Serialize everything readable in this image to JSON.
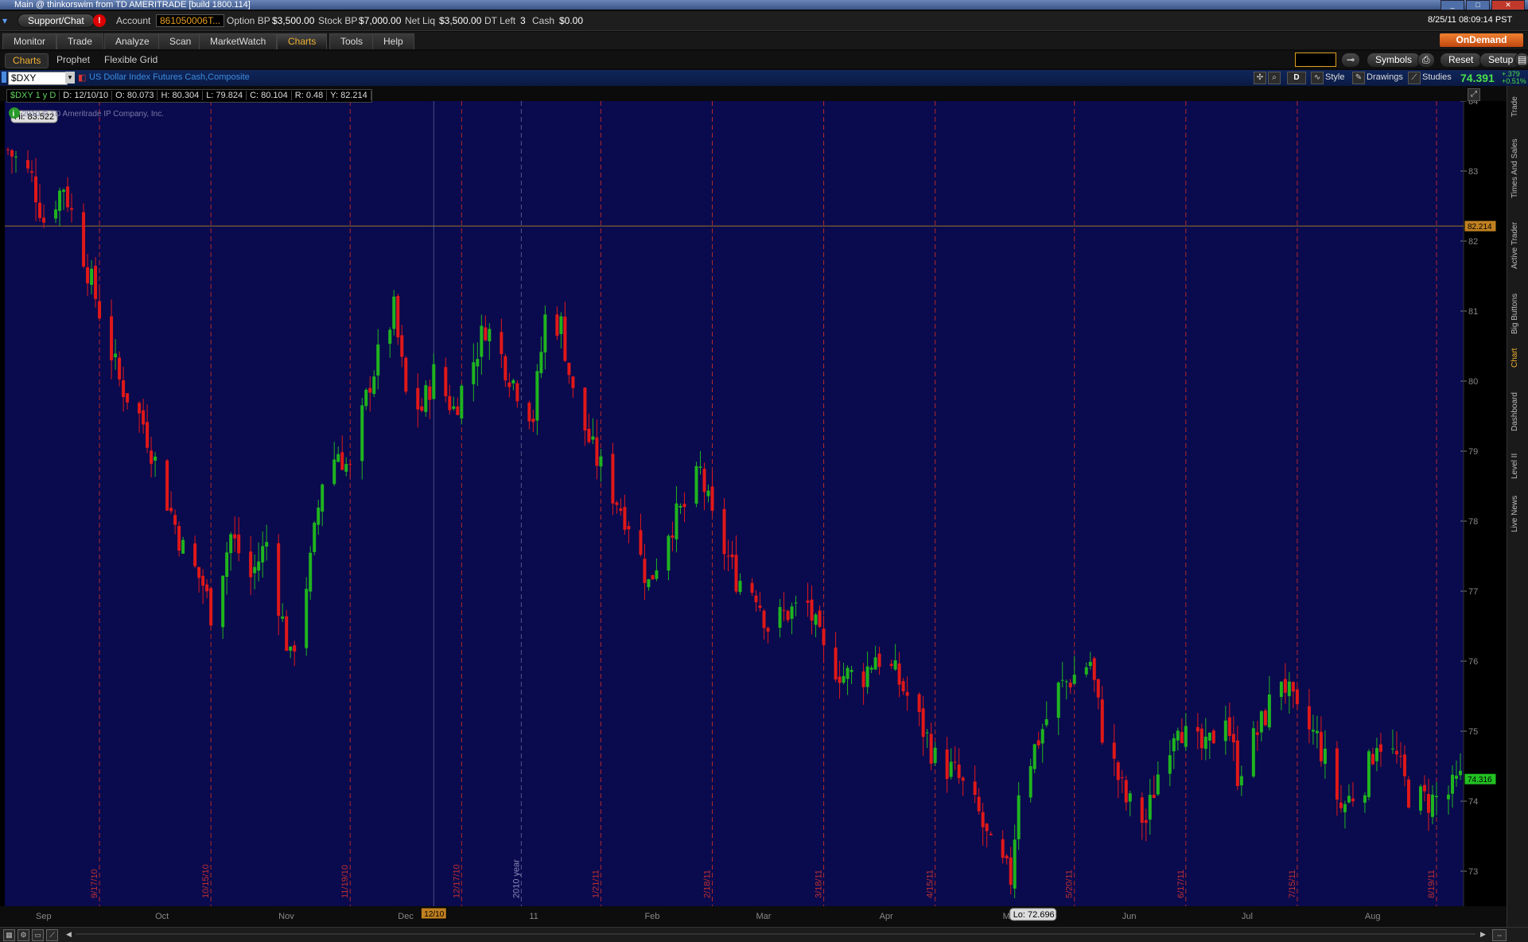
{
  "window": {
    "title": "Main @ thinkorswim from TD AMERITRADE [build 1800.114]"
  },
  "account_bar": {
    "support_label": "Support/Chat",
    "alert_symbol": "!",
    "account_label": "Account",
    "account_value": "861050006T...",
    "option_bp_label": "Option BP",
    "option_bp_value": "$3,500.00",
    "stock_bp_label": "Stock BP",
    "stock_bp_value": "$7,000.00",
    "net_liq_label": "Net Liq",
    "net_liq_value": "$3,500.00",
    "dt_left_label": "DT Left",
    "dt_left_value": "3",
    "cash_label": "Cash",
    "cash_value": "$0.00",
    "datetime": "8/25/11 08:09:14 PST"
  },
  "main_tabs": [
    {
      "label": "Monitor"
    },
    {
      "label": "Trade"
    },
    {
      "label": "Analyze"
    },
    {
      "label": "Scan"
    },
    {
      "label": "MarketWatch"
    },
    {
      "label": "Charts",
      "active": true
    },
    {
      "label": "Tools"
    },
    {
      "label": "Help"
    }
  ],
  "ondemand_label": "OnDemand",
  "sub_tabs": [
    {
      "label": "Charts",
      "active": true
    },
    {
      "label": "Prophet"
    },
    {
      "label": "Flexible Grid"
    }
  ],
  "toolbar": {
    "symbols_label": "Symbols",
    "reset_label": "Reset",
    "setup_label": "Setup"
  },
  "chart_header": {
    "symbol": "$DXY",
    "description": "US Dollar Index Futures Cash,Composite",
    "period_button": "D",
    "style_label": "Style",
    "drawings_label": "Drawings",
    "studies_label": "Studies",
    "last_price": "74.391",
    "change_up": "+.379",
    "change_pct": "+0.51%"
  },
  "info_bar": {
    "symbol_period": "$DXY 1 y D",
    "date": "D: 12/10/10",
    "open": "O: 80.073",
    "high": "H: 80.304",
    "low": "L: 79.824",
    "close": "C: 80.104",
    "range": "R: 0.48",
    "y": "Y: 82.214"
  },
  "side_tabs": [
    {
      "label": "Trade"
    },
    {
      "label": "Times And Sales"
    },
    {
      "label": "Active Trader"
    },
    {
      "label": "Big Buttons"
    },
    {
      "label": "Chart",
      "active": true
    },
    {
      "label": "Dashboard"
    },
    {
      "label": "Level II"
    },
    {
      "label": "Live News"
    }
  ],
  "colors": {
    "chart_bg": "#0a0a4e",
    "up_candle": "#1fb41f",
    "down_candle": "#e01818",
    "grid_red": "#b52a2a",
    "cursor_line": "#c09020"
  },
  "chart_data": {
    "type": "candlestick",
    "copyright": "2010 © TD Ameritrade IP Company, Inc.",
    "ylim": [
      72.5,
      84
    ],
    "y_ticks": [
      73,
      74,
      75,
      76,
      77,
      78,
      79,
      80,
      81,
      82,
      83,
      84
    ],
    "x_range": [
      "2010-08-25",
      "2011-08-25"
    ],
    "month_labels": [
      {
        "label": "Sep",
        "date": "2010-09-01"
      },
      {
        "label": "Oct",
        "date": "2010-10-01"
      },
      {
        "label": "Nov",
        "date": "2010-11-01"
      },
      {
        "label": "Dec",
        "date": "2010-12-01"
      },
      {
        "label": "11",
        "date": "2011-01-03"
      },
      {
        "label": "Feb",
        "date": "2011-02-01"
      },
      {
        "label": "Mar",
        "date": "2011-03-01"
      },
      {
        "label": "Apr",
        "date": "2011-04-01"
      },
      {
        "label": "May",
        "date": "2011-05-02"
      },
      {
        "label": "Jun",
        "date": "2011-06-01"
      },
      {
        "label": "Jul",
        "date": "2011-07-01"
      },
      {
        "label": "Aug",
        "date": "2011-08-01"
      }
    ],
    "expiration_lines": [
      {
        "label": "9/17/10",
        "date": "2010-09-17"
      },
      {
        "label": "10/15/10",
        "date": "2010-10-15"
      },
      {
        "label": "11/19/10",
        "date": "2010-11-19"
      },
      {
        "label": "12/17/10",
        "date": "2010-12-17"
      },
      {
        "label": "1/21/11",
        "date": "2011-01-21"
      },
      {
        "label": "2/18/11",
        "date": "2011-02-18"
      },
      {
        "label": "3/18/11",
        "date": "2011-03-18"
      },
      {
        "label": "4/15/11",
        "date": "2011-04-15"
      },
      {
        "label": "5/20/11",
        "date": "2011-05-20"
      },
      {
        "label": "6/17/11",
        "date": "2011-06-17"
      },
      {
        "label": "7/15/11",
        "date": "2011-07-15"
      },
      {
        "label": "8/19/11",
        "date": "2011-08-19"
      }
    ],
    "year_line": {
      "label": "2010 year",
      "date": "2011-01-01"
    },
    "hi_label": "Hi: 83.522",
    "hi": {
      "date": "2010-08-25",
      "value": 83.522
    },
    "lo_label": "Lo: 72.696",
    "lo": {
      "date": "2011-05-04",
      "value": 72.696
    },
    "cursor_price": "82.214",
    "cursor_value": 82.214,
    "cursor_date_label": "12/10",
    "cursor_date": "2010-12-10",
    "last_price_label": "74.316",
    "last_value": 74.316,
    "close_series": [
      {
        "date": "2010-08-25",
        "close": 83.3
      },
      {
        "date": "2010-08-31",
        "close": 82.9
      },
      {
        "date": "2010-09-03",
        "close": 82.3
      },
      {
        "date": "2010-09-08",
        "close": 82.8
      },
      {
        "date": "2010-09-13",
        "close": 81.8
      },
      {
        "date": "2010-09-17",
        "close": 81.0
      },
      {
        "date": "2010-09-22",
        "close": 80.0
      },
      {
        "date": "2010-09-28",
        "close": 79.4
      },
      {
        "date": "2010-10-04",
        "close": 78.3
      },
      {
        "date": "2010-10-08",
        "close": 77.6
      },
      {
        "date": "2010-10-13",
        "close": 77.1
      },
      {
        "date": "2010-10-15",
        "close": 76.7
      },
      {
        "date": "2010-10-20",
        "close": 77.8
      },
      {
        "date": "2010-10-25",
        "close": 77.2
      },
      {
        "date": "2010-10-29",
        "close": 77.7
      },
      {
        "date": "2010-11-04",
        "close": 76.0
      },
      {
        "date": "2010-11-09",
        "close": 77.4
      },
      {
        "date": "2010-11-12",
        "close": 78.6
      },
      {
        "date": "2010-11-16",
        "close": 79.0
      },
      {
        "date": "2010-11-19",
        "close": 78.7
      },
      {
        "date": "2010-11-24",
        "close": 80.0
      },
      {
        "date": "2010-11-30",
        "close": 81.0
      },
      {
        "date": "2010-12-03",
        "close": 79.8
      },
      {
        "date": "2010-12-07",
        "close": 79.6
      },
      {
        "date": "2010-12-10",
        "close": 80.1
      },
      {
        "date": "2010-12-15",
        "close": 79.6
      },
      {
        "date": "2010-12-20",
        "close": 80.3
      },
      {
        "date": "2010-12-23",
        "close": 80.8
      },
      {
        "date": "2010-12-30",
        "close": 80.0
      },
      {
        "date": "2011-01-04",
        "close": 79.5
      },
      {
        "date": "2011-01-07",
        "close": 80.9
      },
      {
        "date": "2011-01-11",
        "close": 80.8
      },
      {
        "date": "2011-01-14",
        "close": 79.8
      },
      {
        "date": "2011-01-19",
        "close": 79.0
      },
      {
        "date": "2011-01-24",
        "close": 78.4
      },
      {
        "date": "2011-01-28",
        "close": 78.0
      },
      {
        "date": "2011-02-02",
        "close": 77.1
      },
      {
        "date": "2011-02-07",
        "close": 77.9
      },
      {
        "date": "2011-02-11",
        "close": 78.2
      },
      {
        "date": "2011-02-15",
        "close": 78.7
      },
      {
        "date": "2011-02-18",
        "close": 78.0
      },
      {
        "date": "2011-02-24",
        "close": 77.2
      },
      {
        "date": "2011-03-01",
        "close": 77.0
      },
      {
        "date": "2011-03-04",
        "close": 76.5
      },
      {
        "date": "2011-03-09",
        "close": 76.7
      },
      {
        "date": "2011-03-14",
        "close": 76.8
      },
      {
        "date": "2011-03-18",
        "close": 76.1
      },
      {
        "date": "2011-03-23",
        "close": 75.8
      },
      {
        "date": "2011-03-28",
        "close": 75.8
      },
      {
        "date": "2011-03-31",
        "close": 76.1
      },
      {
        "date": "2011-04-05",
        "close": 75.8
      },
      {
        "date": "2011-04-08",
        "close": 75.5
      },
      {
        "date": "2011-04-13",
        "close": 74.9
      },
      {
        "date": "2011-04-15",
        "close": 74.6
      },
      {
        "date": "2011-04-20",
        "close": 74.4
      },
      {
        "date": "2011-04-26",
        "close": 73.8
      },
      {
        "date": "2011-04-29",
        "close": 73.3
      },
      {
        "date": "2011-05-04",
        "close": 72.9
      },
      {
        "date": "2011-05-06",
        "close": 74.2
      },
      {
        "date": "2011-05-11",
        "close": 74.9
      },
      {
        "date": "2011-05-16",
        "close": 75.6
      },
      {
        "date": "2011-05-20",
        "close": 75.8
      },
      {
        "date": "2011-05-24",
        "close": 76.0
      },
      {
        "date": "2011-05-27",
        "close": 75.0
      },
      {
        "date": "2011-06-02",
        "close": 74.0
      },
      {
        "date": "2011-06-07",
        "close": 73.7
      },
      {
        "date": "2011-06-10",
        "close": 74.4
      },
      {
        "date": "2011-06-15",
        "close": 75.2
      },
      {
        "date": "2011-06-17",
        "close": 74.9
      },
      {
        "date": "2011-06-22",
        "close": 74.7
      },
      {
        "date": "2011-06-27",
        "close": 75.3
      },
      {
        "date": "2011-06-30",
        "close": 74.4
      },
      {
        "date": "2011-07-06",
        "close": 75.1
      },
      {
        "date": "2011-07-11",
        "close": 75.8
      },
      {
        "date": "2011-07-15",
        "close": 75.2
      },
      {
        "date": "2011-07-20",
        "close": 74.9
      },
      {
        "date": "2011-07-26",
        "close": 73.9
      },
      {
        "date": "2011-08-01",
        "close": 74.3
      },
      {
        "date": "2011-08-04",
        "close": 74.9
      },
      {
        "date": "2011-08-09",
        "close": 74.6
      },
      {
        "date": "2011-08-12",
        "close": 74.1
      },
      {
        "date": "2011-08-17",
        "close": 74.0
      },
      {
        "date": "2011-08-22",
        "close": 74.1
      },
      {
        "date": "2011-08-25",
        "close": 74.3
      }
    ]
  }
}
